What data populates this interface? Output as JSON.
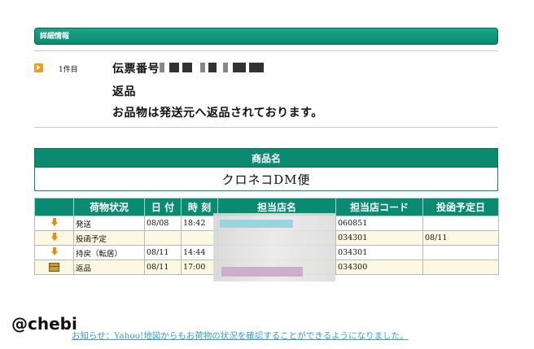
{
  "header": {
    "title": "詳細情報"
  },
  "item": {
    "count": "1件目",
    "slip_label": "伝票番号",
    "status": "返品",
    "message": "お品物は発送元へ返品されております。"
  },
  "goods": {
    "header": "商品名",
    "value": "クロネコDM便"
  },
  "tracking": {
    "headers": [
      "荷物状況",
      "日 付",
      "時 刻",
      "担当店名",
      "担当店コード",
      "投函予定日"
    ],
    "rows": [
      {
        "status": "発送",
        "date": "08/08",
        "time": "18:42",
        "code": "060851",
        "planned": "",
        "icon": "down-arrow-icon"
      },
      {
        "status": "投函予定",
        "date": "",
        "time": "",
        "code": "034301",
        "planned": "08/11",
        "icon": "down-arrow-icon"
      },
      {
        "status": "持戻（転居）",
        "date": "08/11",
        "time": "14:44",
        "code": "034301",
        "planned": "",
        "icon": "down-arrow-icon"
      },
      {
        "status": "返品",
        "date": "08/11",
        "time": "17:00",
        "code": "034300",
        "planned": "",
        "icon": "box-icon"
      }
    ]
  },
  "watermark": "@chebi",
  "notice": "お知らせ：Yahoo!地図からもお荷物の状況を確認することができるようになりました。",
  "colors": {
    "accent": "#0a8a70",
    "arrow": "#f59a1a",
    "link": "#3a9fd0"
  }
}
